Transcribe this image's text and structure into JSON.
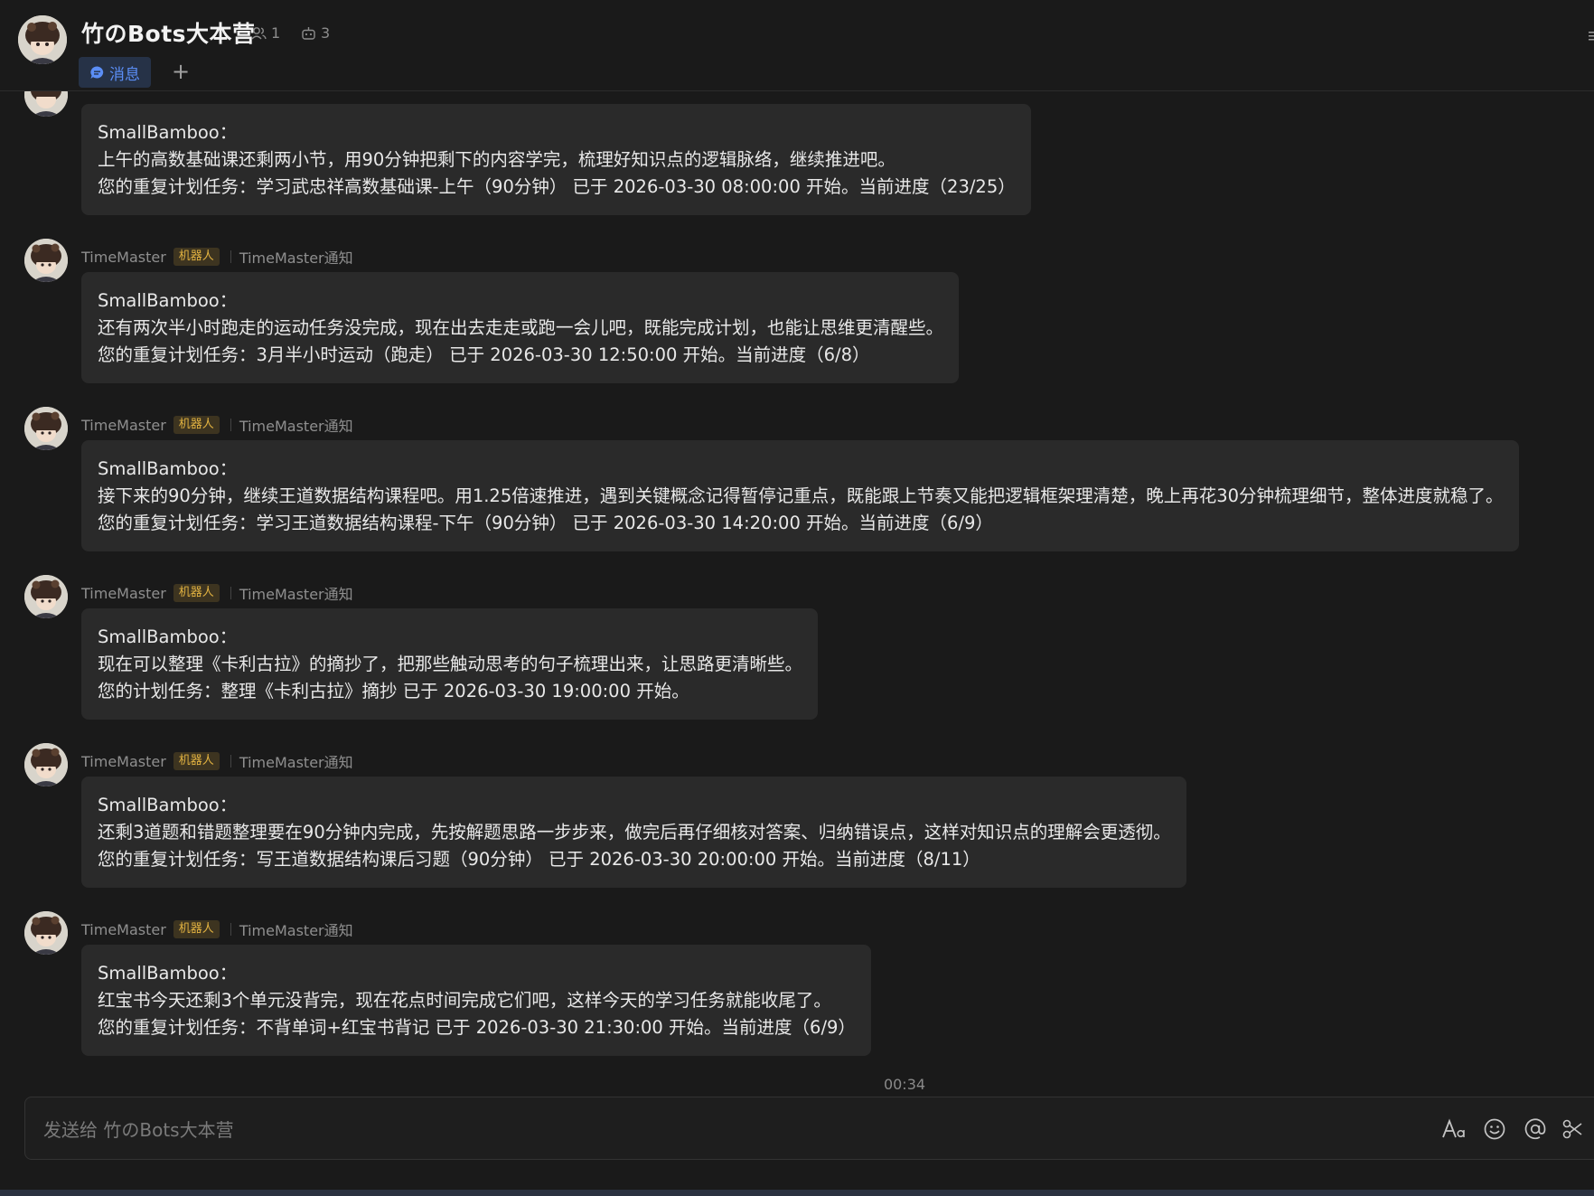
{
  "channel": {
    "title": "竹のBots大本营",
    "member_count": "1",
    "bot_count": "3"
  },
  "tabs": {
    "messages_label": "消息",
    "add_label": "+"
  },
  "partial_message": {
    "lines": [
      "SmallBamboo：",
      "上午的高数基础课还剩两小节，用90分钟把剩下的内容学完，梳理好知识点的逻辑脉络，继续推进吧。",
      "您的重复计划任务：学习武忠祥高数基础课-上午（90分钟） 已于 2026-03-30 08:00:00 开始。当前进度（23/25）"
    ]
  },
  "messages": [
    {
      "sender": "TimeMaster",
      "badge": "机器人",
      "subtitle": "TimeMaster通知",
      "lines": [
        "SmallBamboo：",
        "还有两次半小时跑走的运动任务没完成，现在出去走走或跑一会儿吧，既能完成计划，也能让思维更清醒些。",
        "您的重复计划任务：3月半小时运动（跑走） 已于 2026-03-30 12:50:00 开始。当前进度（6/8）"
      ]
    },
    {
      "sender": "TimeMaster",
      "badge": "机器人",
      "subtitle": "TimeMaster通知",
      "lines": [
        "SmallBamboo：",
        "接下来的90分钟，继续王道数据结构课程吧。用1.25倍速推进，遇到关键概念记得暂停记重点，既能跟上节奏又能把逻辑框架理清楚，晚上再花30分钟梳理细节，整体进度就稳了。",
        "您的重复计划任务：学习王道数据结构课程-下午（90分钟） 已于 2026-03-30 14:20:00 开始。当前进度（6/9）"
      ]
    },
    {
      "sender": "TimeMaster",
      "badge": "机器人",
      "subtitle": "TimeMaster通知",
      "lines": [
        "SmallBamboo：",
        "现在可以整理《卡利古拉》的摘抄了，把那些触动思考的句子梳理出来，让思路更清晰些。",
        "您的计划任务：整理《卡利古拉》摘抄 已于 2026-03-30 19:00:00 开始。"
      ]
    },
    {
      "sender": "TimeMaster",
      "badge": "机器人",
      "subtitle": "TimeMaster通知",
      "lines": [
        "SmallBamboo：",
        "还剩3道题和错题整理要在90分钟内完成，先按解题思路一步步来，做完后再仔细核对答案、归纳错误点，这样对知识点的理解会更透彻。",
        "您的重复计划任务：写王道数据结构课后习题（90分钟） 已于 2026-03-30 20:00:00 开始。当前进度（8/11）"
      ]
    },
    {
      "sender": "TimeMaster",
      "badge": "机器人",
      "subtitle": "TimeMaster通知",
      "lines": [
        "SmallBamboo：",
        "红宝书今天还剩3个单元没背完，现在花点时间完成它们吧，这样今天的学习任务就能收尾了。",
        "您的重复计划任务：不背单词+红宝书背记 已于 2026-03-30 21:30:00 开始。当前进度（6/9）"
      ]
    }
  ],
  "timestamp": "00:34",
  "composer": {
    "placeholder": "发送给 竹のBots大本营"
  },
  "icons": {
    "members": "members-icon",
    "bots": "robot-icon",
    "message_tab": "chat-bubble-icon",
    "format": "text-format-icon",
    "emoji": "emoji-icon",
    "mention": "at-mention-icon",
    "screenshot": "scissors-icon"
  },
  "colors": {
    "background": "#1a1a1a",
    "bubble": "#2a2a2a",
    "accent": "#5b8ef6",
    "badge_text": "#e3b341",
    "badge_bg": "#3d3420"
  }
}
